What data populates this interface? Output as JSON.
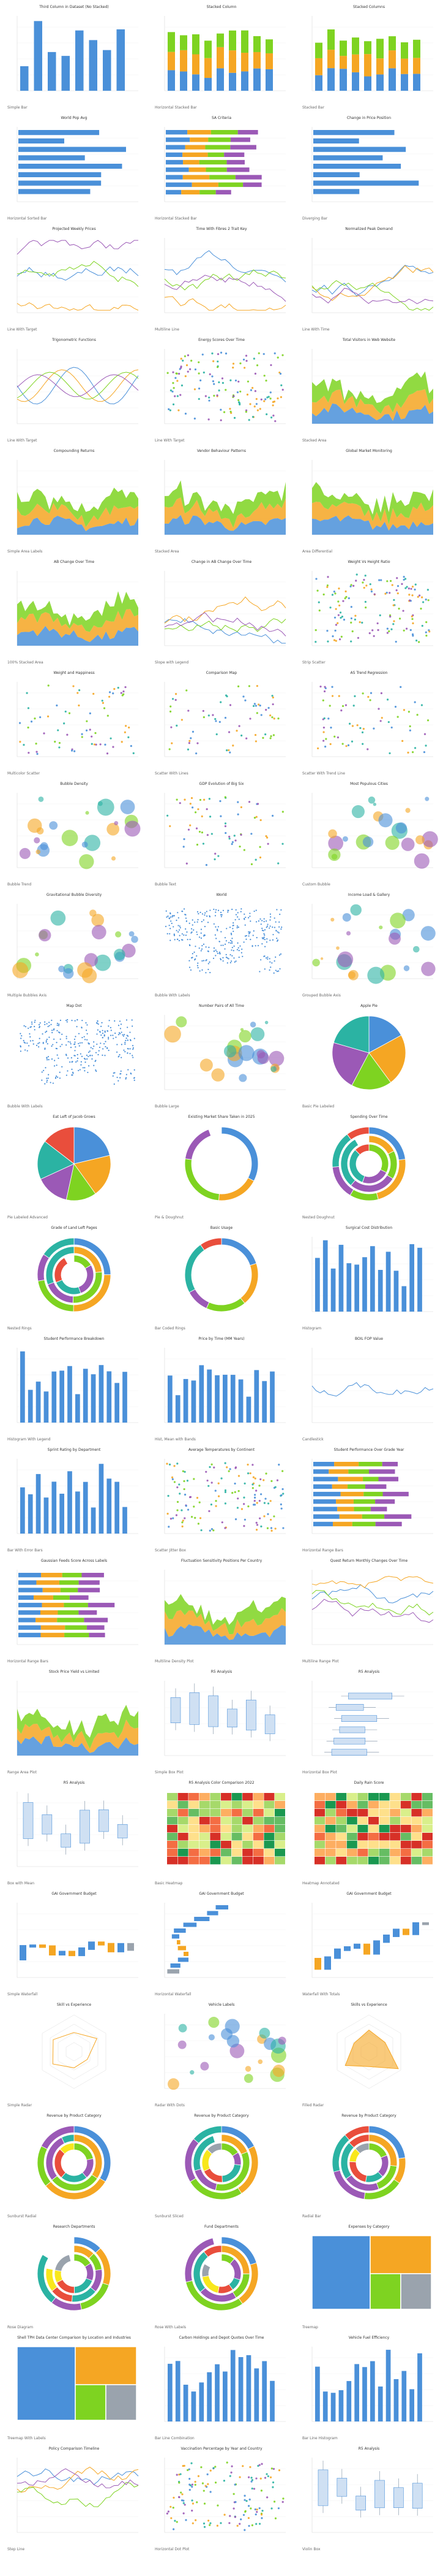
{
  "colors": {
    "blue": "#4a90d9",
    "orange": "#f5a623",
    "green": "#7ed321",
    "purple": "#9b59b6",
    "teal": "#2bb3a3",
    "red": "#e94e3c",
    "yellow": "#f8e71c",
    "gray": "#9aa3ad"
  },
  "gallery": {
    "cells": [
      {
        "title": "Third Column in Dataset (No Stacked)",
        "caption": "Simple Bar",
        "kind": "bar"
      },
      {
        "title": "Stacked Column",
        "caption": "Horizontal Stacked Bar",
        "kind": "stacked"
      },
      {
        "title": "Stacked Columns",
        "caption": "Stacked Bar",
        "kind": "stacked100"
      },
      {
        "title": "World Pop Avg",
        "caption": "Horizontal Sorted Bar",
        "kind": "hbar"
      },
      {
        "title": "SA Criteria",
        "caption": "Horizontal Stacked Bar",
        "kind": "hstack"
      },
      {
        "title": "Change in Price Position",
        "caption": "Diverging Bar",
        "kind": "diverge"
      },
      {
        "title": "Projected Weekly Prices",
        "caption": "Line With Target",
        "kind": "lines"
      },
      {
        "title": "Time With Fibres 2 Trait Key",
        "caption": "Multiline Line",
        "kind": "lines2"
      },
      {
        "title": "Normalized Peak Demand",
        "caption": "Line With Time",
        "kind": "lines3"
      },
      {
        "title": "Trigonometric Functions",
        "caption": "Line With Target",
        "kind": "trig"
      },
      {
        "title": "Energy Scores Over Time",
        "caption": "Line With Target",
        "kind": "dots"
      },
      {
        "title": "Total Visitors in Web Website",
        "caption": "Stacked Area",
        "kind": "area"
      },
      {
        "title": "Compounding Returns",
        "caption": "Simple Area Labels",
        "kind": "area2"
      },
      {
        "title": "Vendor Behaviour Patterns",
        "caption": "Stacked Area",
        "kind": "area3"
      },
      {
        "title": "Global Market Monitoring",
        "caption": "Area Differential",
        "kind": "area4"
      },
      {
        "title": "AB Change Over Time",
        "caption": "100% Stacked Area",
        "kind": "area5"
      },
      {
        "title": "Change in AB Change Over Time",
        "caption": "Slope with Legend",
        "kind": "slope"
      },
      {
        "title": "Weight Vs Height Ratio",
        "caption": "Strip Scatter",
        "kind": "strip"
      },
      {
        "title": "Weight and Happiness",
        "caption": "Multicolor Scatter",
        "kind": "scatter"
      },
      {
        "title": "Comparison Map",
        "caption": "Scatter With Lines",
        "kind": "scatter2"
      },
      {
        "title": "AS Trend Regression",
        "caption": "Scatter With Trend Line",
        "kind": "scatter3"
      },
      {
        "title": "Bubble Density",
        "caption": "Bubble Trend",
        "kind": "bubbles"
      },
      {
        "title": "GDP Evolution of Big Six",
        "caption": "Bubble Text",
        "kind": "scatter4"
      },
      {
        "title": "Most Populous Cities",
        "caption": "Custom Bubble",
        "kind": "bubbles2"
      },
      {
        "title": "Gravitational Bubble Diversity",
        "caption": "Multiple Bubbles Axis",
        "kind": "bubbles3"
      },
      {
        "title": "World",
        "caption": "Bubble With Labels",
        "kind": "map"
      },
      {
        "title": "Income Load & Gallery",
        "caption": "Grouped Bubble Axis",
        "kind": "bubbles4"
      },
      {
        "title": "Map Dot",
        "caption": "Bubble With Labels",
        "kind": "dotmap"
      },
      {
        "title": "Number Pairs of All Time",
        "caption": "Bubble Large",
        "kind": "bubbles5"
      },
      {
        "title": "Apple Pie",
        "caption": "Basic Pie Labeled",
        "kind": "pie"
      },
      {
        "title": "Eat Left of Jacob Grows",
        "caption": "Pie Labeled Advanced",
        "kind": "pie2"
      },
      {
        "title": "Existing Market Share Taken in 2025",
        "caption": "Pie & Doughnut",
        "kind": "donut"
      },
      {
        "title": "Spending Over Time",
        "caption": "Nested Doughnut",
        "kind": "donut2"
      },
      {
        "title": "Grade of Land Left Pages",
        "caption": "Nested Rings",
        "kind": "rings"
      },
      {
        "title": "Basic Usage",
        "caption": "Bar Coded Rings",
        "kind": "donut3"
      },
      {
        "title": "Surgical Cost Distribution",
        "caption": "Histogram",
        "kind": "hist"
      },
      {
        "title": "Student Performance Breakdown",
        "caption": "Histogram With Legend",
        "kind": "hist2"
      },
      {
        "title": "Price by Time (MM Years)",
        "caption": "Hist, Mean with Bands",
        "kind": "hist3"
      },
      {
        "title": "BOIL FOP Value",
        "caption": "Candlestick",
        "kind": "candle"
      },
      {
        "title": "Sprint Rating by Department",
        "caption": "Bar With Error Bars",
        "kind": "errbar"
      },
      {
        "title": "Average Temperatures by Continent",
        "caption": "Scatter Jitter Box",
        "kind": "jitter"
      },
      {
        "title": "Student Performance Over Grade Year",
        "caption": "Horizontal Range Bars",
        "kind": "range"
      },
      {
        "title": "Gaussian Feeds Score Across Labels",
        "caption": "Horizontal Range Bars",
        "kind": "range2"
      },
      {
        "title": "Fluctuation Sensitivity Positions Per Country",
        "caption": "Multiline Density Plot",
        "kind": "ridge"
      },
      {
        "title": "Quest Return Monthly Changes Over Time",
        "caption": "Multiline Range Plot",
        "kind": "bandline"
      },
      {
        "title": "Stock Price Yield vs Limited",
        "caption": "Range Area Plot",
        "kind": "rangearea"
      },
      {
        "title": "R5 Analysis",
        "caption": "Simple Box Plot",
        "kind": "box"
      },
      {
        "title": "R5 Analysis",
        "caption": "Horizontal Box Plot",
        "kind": "hbox"
      },
      {
        "title": "R5 Analysis",
        "caption": "Box with Mean",
        "kind": "box2"
      },
      {
        "title": "R5 Analysis Color Comparison 2022",
        "caption": "Basic Heatmap",
        "kind": "heat"
      },
      {
        "title": "Daily Rain Score",
        "caption": "Heatmap Annotated",
        "kind": "heat2"
      },
      {
        "title": "GAI Government Budget",
        "caption": "Simple Waterfall",
        "kind": "waterfall"
      },
      {
        "title": "GAI Government Budget",
        "caption": "Horizontal Waterfall",
        "kind": "waterfall2"
      },
      {
        "title": "GAI Government Budget",
        "caption": "Waterfall With Totals",
        "kind": "waterfall3"
      },
      {
        "title": "Skill vs Experience",
        "caption": "Simple Radar",
        "kind": "radar"
      },
      {
        "title": "Vehicle Labels",
        "caption": "Radar With Dots",
        "kind": "polar"
      },
      {
        "title": "Skills vs Experience",
        "caption": "Filled Radar",
        "kind": "radar2"
      },
      {
        "title": "Revenue by Product Category",
        "caption": "Sunburst Radial",
        "kind": "sunburst"
      },
      {
        "title": "Revenue by Product Category",
        "caption": "Sunburst Sliced",
        "kind": "sunburst2"
      },
      {
        "title": "Revenue by Product Category",
        "caption": "Radial Bar",
        "kind": "radialbar"
      },
      {
        "title": "Research Departments",
        "caption": "Rose Diagram",
        "kind": "rose"
      },
      {
        "title": "Fund Departments",
        "caption": "Rose With Labels",
        "kind": "rose2"
      },
      {
        "title": "Expenses by Category",
        "caption": "Treemap",
        "kind": "treemap"
      },
      {
        "title": "Shell TPH Data Center Comparison by Location and Industries",
        "caption": "Treemap With Labels",
        "kind": "treemap2"
      },
      {
        "title": "Carbon Holdings and Depot Quotes Over Time",
        "caption": "Bar Line Combination",
        "kind": "barline"
      },
      {
        "title": "Vehicle Fuel Efficiency",
        "caption": "Bar Line Histogram",
        "kind": "barline2"
      },
      {
        "title": "Policy Comparison Timeline",
        "caption": "Step Line",
        "kind": "step"
      },
      {
        "title": "Vaccination Percentage by Year and Country",
        "caption": "Horizontal Dot Plot",
        "kind": "dotplot"
      },
      {
        "title": "R5 Analysis",
        "caption": "Violin Box",
        "kind": "box3"
      }
    ]
  }
}
